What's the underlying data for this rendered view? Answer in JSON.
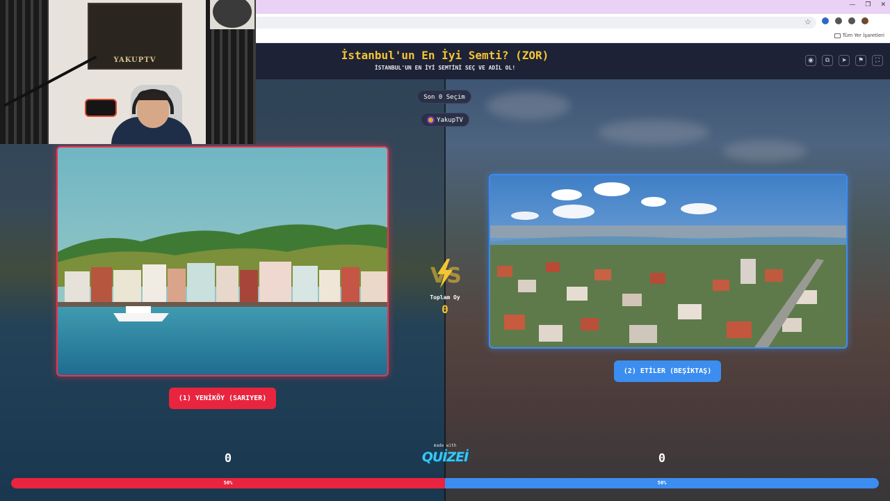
{
  "browser": {
    "bookmarks_all": "Tüm Yer İşaretleri",
    "window_controls": [
      "—",
      "❐",
      "✕"
    ],
    "extension_colors": [
      "#3166c9",
      "#555555",
      "#555555",
      "#6b4a2f"
    ]
  },
  "quiz": {
    "title": "İstanbul'un En İyi Semti? (ZOR)",
    "subtitle": "İSTANBUL'UN EN İYİ SEMTİNİ SEÇ VE ADİL OL!",
    "last_choices": "Son 0 Seçim",
    "user": "YakupTV",
    "header_icons": [
      "eye-icon",
      "copy-icon",
      "send-icon",
      "flag-icon",
      "fullscreen-icon"
    ],
    "header_icon_glyphs": [
      "◉",
      "⧉",
      "➤",
      "⚑",
      "⛶"
    ],
    "total_label": "Toplam Oy",
    "total_value": "0",
    "left": {
      "label": "(1) YENİKÖY (SARIYER)",
      "score": "0",
      "percent": "50%",
      "color": "#e8243f"
    },
    "right": {
      "label": "(2) ETİLER (BEŞİKTAŞ)",
      "score": "0",
      "percent": "50%",
      "color": "#3b8df0"
    },
    "made_with": "made with",
    "brand": "QUİZEİ",
    "accent_color": "#f4c533"
  },
  "webcam": {
    "poster_text": "YAKUPTV"
  }
}
